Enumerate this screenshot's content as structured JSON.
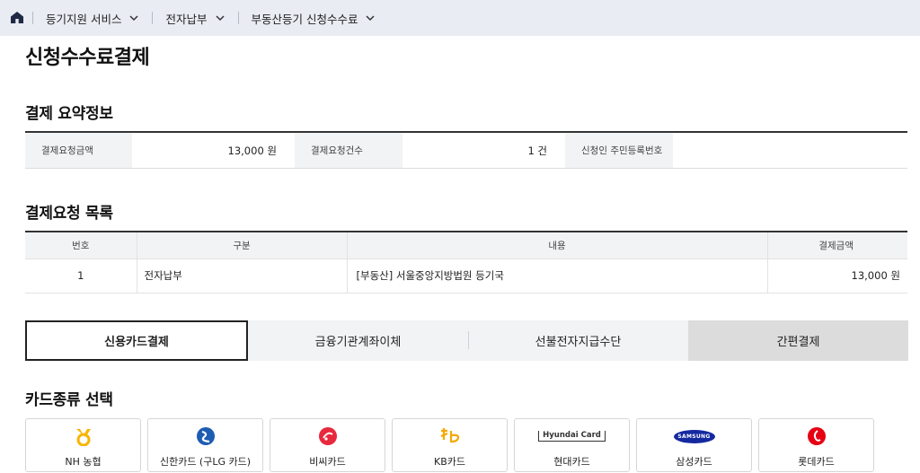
{
  "breadcrumb": {
    "items": [
      {
        "label": "등기지원 서비스"
      },
      {
        "label": "전자납부"
      },
      {
        "label": "부동산등기 신청수수료"
      }
    ]
  },
  "page_title": "신청수수료결제",
  "summary": {
    "title": "결제 요약정보",
    "amount_label": "결제요청금액",
    "amount_value": "13,000 원",
    "count_label": "결제요청건수",
    "count_value": "1 건",
    "applicant_label": "신청인 주민등록번호",
    "applicant_value": ""
  },
  "request_list": {
    "title": "결제요청 목록",
    "columns": [
      "번호",
      "구분",
      "내용",
      "결제금액"
    ],
    "rows": [
      {
        "no": "1",
        "type": "전자납부",
        "content": "[부동산] 서울중앙지방법원 등기국",
        "amount": "13,000 원"
      }
    ]
  },
  "payment_tabs": [
    {
      "label": "신용카드결제",
      "active": true
    },
    {
      "label": "금융기관계좌이체",
      "active": false
    },
    {
      "label": "선불전자지급수단",
      "active": false
    },
    {
      "label": "간편결제",
      "active": false
    }
  ],
  "card_select": {
    "title": "카드종류 선택",
    "cards": [
      {
        "name": "NH 농협",
        "icon": "nh-logo-icon",
        "color": "#f7b500"
      },
      {
        "name": "신한카드 (구LG 카드)",
        "icon": "shinhan-logo-icon",
        "color": "#1e5cb3"
      },
      {
        "name": "비씨카드",
        "icon": "bc-logo-icon",
        "color": "#e8283c"
      },
      {
        "name": "KB카드",
        "icon": "kb-logo-icon",
        "color": "#f5a800"
      },
      {
        "name": "현대카드",
        "icon": "hyundai-logo-icon",
        "logo_text": "Hyundai Card",
        "color": "#333333"
      },
      {
        "name": "삼성카드",
        "icon": "samsung-logo-icon",
        "logo_text": "SAMSUNG",
        "color": "#1428a0"
      },
      {
        "name": "롯데카드",
        "icon": "lotte-logo-icon",
        "color": "#e60012"
      }
    ]
  }
}
